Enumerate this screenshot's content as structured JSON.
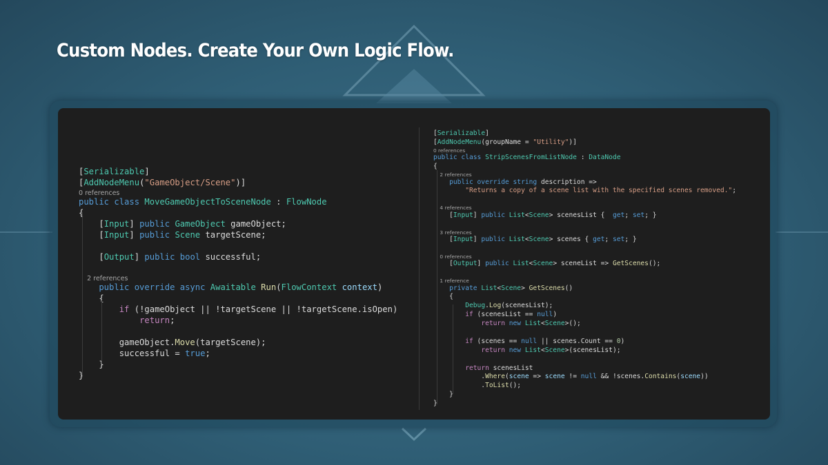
{
  "title": "Custom Nodes. Create Your Own Logic Flow.",
  "colors": {
    "keyword": "#569cd6",
    "type": "#4ec9b0",
    "control": "#c586c0",
    "string": "#d69d85",
    "method": "#dcdcaa",
    "parameter": "#9cdcfe",
    "number": "#b5cea8",
    "editor_background": "#1e1e1e"
  },
  "left_code": [
    {
      "tokens": [
        {
          "t": "[",
          "c": "b"
        },
        {
          "t": "Serializable",
          "c": "t"
        },
        {
          "t": "]",
          "c": "b"
        }
      ]
    },
    {
      "tokens": [
        {
          "t": "[",
          "c": "b"
        },
        {
          "t": "AddNodeMenu",
          "c": "t"
        },
        {
          "t": "(",
          "c": "b"
        },
        {
          "t": "\"GameObject/Scene\"",
          "c": "s"
        },
        {
          "t": ")]",
          "c": "b"
        }
      ]
    },
    {
      "ref": "0 references"
    },
    {
      "tokens": [
        {
          "t": "public class ",
          "c": "k"
        },
        {
          "t": "MoveGameObjectToSceneNode",
          "c": "t"
        },
        {
          "t": " : ",
          "c": "b"
        },
        {
          "t": "FlowNode",
          "c": "t"
        }
      ]
    },
    {
      "tokens": [
        {
          "t": "{",
          "c": "b"
        }
      ]
    },
    {
      "tokens": [
        {
          "t": "    [",
          "c": "b"
        },
        {
          "t": "Input",
          "c": "t"
        },
        {
          "t": "] ",
          "c": "b"
        },
        {
          "t": "public ",
          "c": "k"
        },
        {
          "t": "GameObject",
          "c": "t"
        },
        {
          "t": " gameObject;",
          "c": "b"
        }
      ]
    },
    {
      "tokens": [
        {
          "t": "    [",
          "c": "b"
        },
        {
          "t": "Input",
          "c": "t"
        },
        {
          "t": "] ",
          "c": "b"
        },
        {
          "t": "public ",
          "c": "k"
        },
        {
          "t": "Scene",
          "c": "t"
        },
        {
          "t": " targetScene;",
          "c": "b"
        }
      ]
    },
    {
      "tokens": [
        {
          "t": "",
          "c": "b"
        }
      ]
    },
    {
      "tokens": [
        {
          "t": "    [",
          "c": "b"
        },
        {
          "t": "Output",
          "c": "t"
        },
        {
          "t": "] ",
          "c": "b"
        },
        {
          "t": "public bool",
          "c": "k"
        },
        {
          "t": " successful;",
          "c": "b"
        }
      ]
    },
    {
      "tokens": [
        {
          "t": "",
          "c": "b"
        }
      ]
    },
    {
      "ref": "    2 references"
    },
    {
      "tokens": [
        {
          "t": "    public override async ",
          "c": "k"
        },
        {
          "t": "Awaitable",
          "c": "t"
        },
        {
          "t": " ",
          "c": "b"
        },
        {
          "t": "Run",
          "c": "f"
        },
        {
          "t": "(",
          "c": "b"
        },
        {
          "t": "FlowContext",
          "c": "t"
        },
        {
          "t": " ",
          "c": "b"
        },
        {
          "t": "context",
          "c": "p"
        },
        {
          "t": ")",
          "c": "b"
        }
      ]
    },
    {
      "tokens": [
        {
          "t": "    {",
          "c": "b"
        }
      ]
    },
    {
      "tokens": [
        {
          "t": "        ",
          "c": "b"
        },
        {
          "t": "if",
          "c": "c"
        },
        {
          "t": " (!gameObject || !targetScene || !targetScene.isOpen)",
          "c": "b"
        }
      ]
    },
    {
      "tokens": [
        {
          "t": "            ",
          "c": "b"
        },
        {
          "t": "return",
          "c": "c"
        },
        {
          "t": ";",
          "c": "b"
        }
      ]
    },
    {
      "tokens": [
        {
          "t": "",
          "c": "b"
        }
      ]
    },
    {
      "tokens": [
        {
          "t": "        gameObject.",
          "c": "b"
        },
        {
          "t": "Move",
          "c": "f"
        },
        {
          "t": "(targetScene);",
          "c": "b"
        }
      ]
    },
    {
      "tokens": [
        {
          "t": "        successful = ",
          "c": "b"
        },
        {
          "t": "true",
          "c": "k"
        },
        {
          "t": ";",
          "c": "b"
        }
      ]
    },
    {
      "tokens": [
        {
          "t": "    }",
          "c": "b"
        }
      ]
    },
    {
      "tokens": [
        {
          "t": "}",
          "c": "b"
        }
      ]
    }
  ],
  "right_code": [
    {
      "tokens": [
        {
          "t": "[",
          "c": "b"
        },
        {
          "t": "Serializable",
          "c": "t"
        },
        {
          "t": "]",
          "c": "b"
        }
      ]
    },
    {
      "tokens": [
        {
          "t": "[",
          "c": "b"
        },
        {
          "t": "AddNodeMenu",
          "c": "t"
        },
        {
          "t": "(groupName = ",
          "c": "b"
        },
        {
          "t": "\"Utility\"",
          "c": "s"
        },
        {
          "t": ")]",
          "c": "b"
        }
      ]
    },
    {
      "ref": "0 references"
    },
    {
      "tokens": [
        {
          "t": "public class ",
          "c": "k"
        },
        {
          "t": "StripScenesFromListNode",
          "c": "t"
        },
        {
          "t": " : ",
          "c": "b"
        },
        {
          "t": "DataNode",
          "c": "t"
        }
      ]
    },
    {
      "tokens": [
        {
          "t": "{",
          "c": "b"
        }
      ]
    },
    {
      "ref": "    2 references"
    },
    {
      "tokens": [
        {
          "t": "    public override string ",
          "c": "k"
        },
        {
          "t": "description =>",
          "c": "b"
        }
      ]
    },
    {
      "tokens": [
        {
          "t": "        ",
          "c": "b"
        },
        {
          "t": "\"Returns a copy of a scene list with the specified scenes removed.\"",
          "c": "s"
        },
        {
          "t": ";",
          "c": "b"
        }
      ]
    },
    {
      "tokens": [
        {
          "t": "",
          "c": "b"
        }
      ]
    },
    {
      "ref": "    4 references"
    },
    {
      "tokens": [
        {
          "t": "    [",
          "c": "b"
        },
        {
          "t": "Input",
          "c": "t"
        },
        {
          "t": "] ",
          "c": "b"
        },
        {
          "t": "public ",
          "c": "k"
        },
        {
          "t": "List",
          "c": "t"
        },
        {
          "t": "<",
          "c": "b"
        },
        {
          "t": "Scene",
          "c": "t"
        },
        {
          "t": "> scenesList {  ",
          "c": "b"
        },
        {
          "t": "get",
          "c": "k"
        },
        {
          "t": "; ",
          "c": "b"
        },
        {
          "t": "set",
          "c": "k"
        },
        {
          "t": "; }",
          "c": "b"
        }
      ]
    },
    {
      "tokens": [
        {
          "t": "",
          "c": "b"
        }
      ]
    },
    {
      "ref": "    3 references"
    },
    {
      "tokens": [
        {
          "t": "    [",
          "c": "b"
        },
        {
          "t": "Input",
          "c": "t"
        },
        {
          "t": "] ",
          "c": "b"
        },
        {
          "t": "public ",
          "c": "k"
        },
        {
          "t": "List",
          "c": "t"
        },
        {
          "t": "<",
          "c": "b"
        },
        {
          "t": "Scene",
          "c": "t"
        },
        {
          "t": "> scenes { ",
          "c": "b"
        },
        {
          "t": "get",
          "c": "k"
        },
        {
          "t": "; ",
          "c": "b"
        },
        {
          "t": "set",
          "c": "k"
        },
        {
          "t": "; }",
          "c": "b"
        }
      ]
    },
    {
      "tokens": [
        {
          "t": "",
          "c": "b"
        }
      ]
    },
    {
      "ref": "    0 references"
    },
    {
      "tokens": [
        {
          "t": "    [",
          "c": "b"
        },
        {
          "t": "Output",
          "c": "t"
        },
        {
          "t": "] ",
          "c": "b"
        },
        {
          "t": "public ",
          "c": "k"
        },
        {
          "t": "List",
          "c": "t"
        },
        {
          "t": "<",
          "c": "b"
        },
        {
          "t": "Scene",
          "c": "t"
        },
        {
          "t": "> sceneList => ",
          "c": "b"
        },
        {
          "t": "GetScenes",
          "c": "f"
        },
        {
          "t": "();",
          "c": "b"
        }
      ]
    },
    {
      "tokens": [
        {
          "t": "",
          "c": "b"
        }
      ]
    },
    {
      "ref": "    1 reference"
    },
    {
      "tokens": [
        {
          "t": "    private ",
          "c": "k"
        },
        {
          "t": "List",
          "c": "t"
        },
        {
          "t": "<",
          "c": "b"
        },
        {
          "t": "Scene",
          "c": "t"
        },
        {
          "t": "> ",
          "c": "b"
        },
        {
          "t": "GetScenes",
          "c": "f"
        },
        {
          "t": "()",
          "c": "b"
        }
      ]
    },
    {
      "tokens": [
        {
          "t": "    {",
          "c": "b"
        }
      ]
    },
    {
      "tokens": [
        {
          "t": "        ",
          "c": "b"
        },
        {
          "t": "Debug",
          "c": "t"
        },
        {
          "t": ".",
          "c": "b"
        },
        {
          "t": "Log",
          "c": "f"
        },
        {
          "t": "(scenesList);",
          "c": "b"
        }
      ]
    },
    {
      "tokens": [
        {
          "t": "        ",
          "c": "b"
        },
        {
          "t": "if",
          "c": "c"
        },
        {
          "t": " (scenesList == ",
          "c": "b"
        },
        {
          "t": "null",
          "c": "k"
        },
        {
          "t": ")",
          "c": "b"
        }
      ]
    },
    {
      "tokens": [
        {
          "t": "            ",
          "c": "b"
        },
        {
          "t": "return ",
          "c": "c"
        },
        {
          "t": "new ",
          "c": "k"
        },
        {
          "t": "List",
          "c": "t"
        },
        {
          "t": "<",
          "c": "b"
        },
        {
          "t": "Scene",
          "c": "t"
        },
        {
          "t": ">();",
          "c": "b"
        }
      ]
    },
    {
      "tokens": [
        {
          "t": "",
          "c": "b"
        }
      ]
    },
    {
      "tokens": [
        {
          "t": "        ",
          "c": "b"
        },
        {
          "t": "if",
          "c": "c"
        },
        {
          "t": " (scenes == ",
          "c": "b"
        },
        {
          "t": "null",
          "c": "k"
        },
        {
          "t": " || scenes.Count == ",
          "c": "b"
        },
        {
          "t": "0",
          "c": "n"
        },
        {
          "t": ")",
          "c": "b"
        }
      ]
    },
    {
      "tokens": [
        {
          "t": "            ",
          "c": "b"
        },
        {
          "t": "return ",
          "c": "c"
        },
        {
          "t": "new ",
          "c": "k"
        },
        {
          "t": "List",
          "c": "t"
        },
        {
          "t": "<",
          "c": "b"
        },
        {
          "t": "Scene",
          "c": "t"
        },
        {
          "t": ">(scenesList);",
          "c": "b"
        }
      ]
    },
    {
      "tokens": [
        {
          "t": "",
          "c": "b"
        }
      ]
    },
    {
      "tokens": [
        {
          "t": "        ",
          "c": "b"
        },
        {
          "t": "return",
          "c": "c"
        },
        {
          "t": " scenesList",
          "c": "b"
        }
      ]
    },
    {
      "tokens": [
        {
          "t": "            .",
          "c": "b"
        },
        {
          "t": "Where",
          "c": "f"
        },
        {
          "t": "(",
          "c": "b"
        },
        {
          "t": "scene",
          "c": "p"
        },
        {
          "t": " => ",
          "c": "b"
        },
        {
          "t": "scene",
          "c": "p"
        },
        {
          "t": " != ",
          "c": "b"
        },
        {
          "t": "null",
          "c": "k"
        },
        {
          "t": " && !scenes.",
          "c": "b"
        },
        {
          "t": "Contains",
          "c": "f"
        },
        {
          "t": "(",
          "c": "b"
        },
        {
          "t": "scene",
          "c": "p"
        },
        {
          "t": "))",
          "c": "b"
        }
      ]
    },
    {
      "tokens": [
        {
          "t": "            .",
          "c": "b"
        },
        {
          "t": "ToList",
          "c": "f"
        },
        {
          "t": "();",
          "c": "b"
        }
      ]
    },
    {
      "tokens": [
        {
          "t": "    }",
          "c": "b"
        }
      ]
    },
    {
      "tokens": [
        {
          "t": "}",
          "c": "b"
        }
      ]
    }
  ]
}
